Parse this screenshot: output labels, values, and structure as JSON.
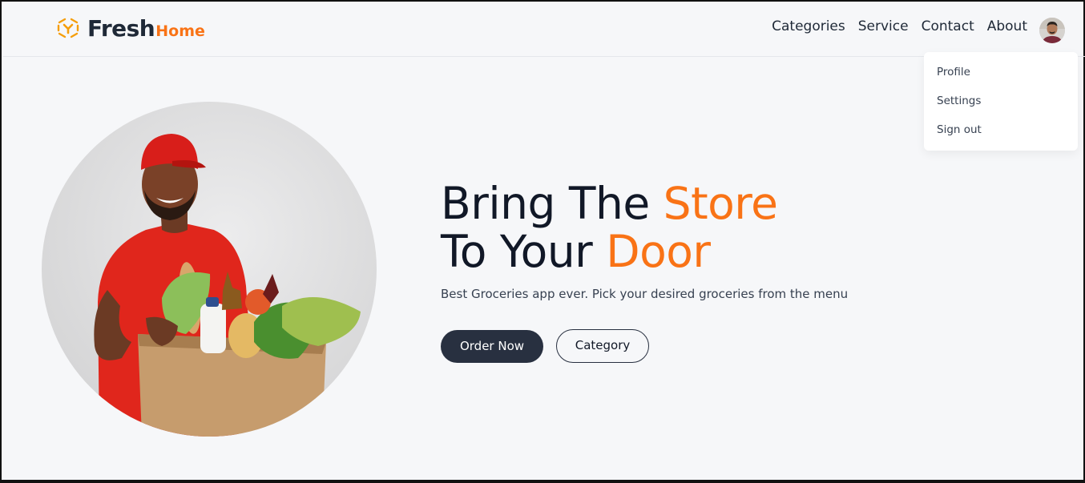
{
  "brand": {
    "name_main": "Fresh",
    "name_sub": "Home",
    "accent_color": "#f97316",
    "icon": "logo-icon"
  },
  "nav": {
    "items": [
      "Categories",
      "Service",
      "Contact",
      "About"
    ]
  },
  "user_menu": {
    "avatar_icon": "user-avatar",
    "items": [
      "Profile",
      "Settings",
      "Sign out"
    ]
  },
  "hero": {
    "headline_line1_plain": "Bring The ",
    "headline_line1_accent": "Store",
    "headline_line2_plain": "To Your ",
    "headline_line2_accent": "Door",
    "subtext": "Best Groceries app ever. Pick your desired groceries from the menu",
    "primary_button": "Order Now",
    "secondary_button": "Category",
    "image": "delivery-man-with-grocery-box"
  },
  "colors": {
    "dark": "#283040",
    "background": "#f6f7f9",
    "accent": "#f97316"
  }
}
